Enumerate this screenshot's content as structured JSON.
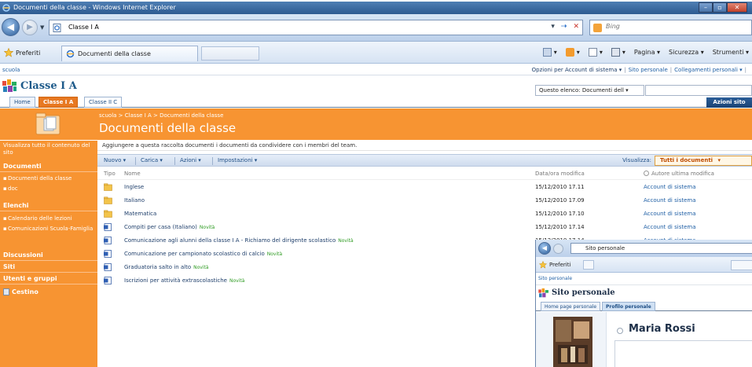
{
  "browser": {
    "window_title": "Documenti della classe - Windows Internet Explorer",
    "address": "Classe I A",
    "search_placeholder": "Bing",
    "favorites_label": "Preferiti",
    "tab_label": "Documenti della classe",
    "commands": {
      "pagina": "Pagina ▾",
      "sicurezza": "Sicurezza ▾",
      "strumenti": "Strumenti ▾"
    }
  },
  "sharepoint": {
    "site_link": "scuola",
    "top_links": {
      "account": "Opzioni per Account di sistema ▾",
      "sito_personale": "Sito personale",
      "collegamenti": "Collegamenti personali ▾"
    },
    "site_title": "Classe I A",
    "search_scope": "Questo elenco: Documenti dell",
    "tabs": [
      "Home",
      "Classe I A",
      "Classe II C"
    ],
    "site_actions": "Azioni sito",
    "breadcrumb": "scuola > Classe I A > Documenti della classe",
    "page_title": "Documenti della classe",
    "description": "Aggiungere a questa raccolta documenti i documenti da condividere con i membri del team.",
    "left_nav": {
      "view_all": "Visualizza tutto il contenuto del sito",
      "documenti_head": "Documenti",
      "documenti_items": [
        "Documenti della classe",
        "doc"
      ],
      "elenchi_head": "Elenchi",
      "elenchi_items": [
        "Calendario delle lezioni",
        "Comunicazioni Scuola-Famiglia"
      ],
      "discussioni": "Discussioni",
      "siti": "Siti",
      "utenti": "Utenti e gruppi",
      "cestino": "Cestino"
    },
    "toolbar": {
      "nuovo": "Nuovo ▾",
      "carica": "Carica ▾",
      "azioni": "Azioni ▾",
      "impostazioni": "Impostazioni ▾",
      "view_label": "Visualizza:",
      "view_value": "Tutti i documenti"
    },
    "columns": {
      "tipo": "Tipo",
      "nome": "Nome",
      "data": "Data/ora modifica",
      "autore": "Autore ultima modifica"
    },
    "new_badge": "Novità",
    "rows": [
      {
        "type": "folder",
        "name": "Inglese",
        "date": "15/12/2010 17.11",
        "author": "Account di sistema",
        "new": false
      },
      {
        "type": "folder",
        "name": "Italiano",
        "date": "15/12/2010 17.09",
        "author": "Account di sistema",
        "new": false
      },
      {
        "type": "folder",
        "name": "Matematica",
        "date": "15/12/2010 17.10",
        "author": "Account di sistema",
        "new": false
      },
      {
        "type": "doc",
        "name": "Compiti per casa (Italiano)",
        "date": "15/12/2010 17.14",
        "author": "Account di sistema",
        "new": true
      },
      {
        "type": "doc",
        "name": "Comunicazione agli alunni della classe I A - Richiamo del dirigente scolastico",
        "date": "15/12/2010 17.14",
        "author": "Account di sistema",
        "new": true
      },
      {
        "type": "doc",
        "name": "Comunicazione per campionato scolastico di calcio",
        "date": "",
        "author": "",
        "new": true
      },
      {
        "type": "doc",
        "name": "Graduatoria salto in alto",
        "date": "",
        "author": "",
        "new": true
      },
      {
        "type": "doc",
        "name": "Iscrizioni per attività extrascolastiche",
        "date": "",
        "author": "",
        "new": true
      }
    ]
  },
  "popup": {
    "address": "Sito personale",
    "favorites_label": "Preferiti",
    "site_link": "Sito personale",
    "title": "Sito personale",
    "tabs": [
      "Home page personale",
      "Profilo personale"
    ],
    "name": "Maria Rossi"
  },
  "colors": {
    "accent_orange": "#f79432",
    "link_blue": "#1f5fa5",
    "new_green": "#2e9b22"
  }
}
